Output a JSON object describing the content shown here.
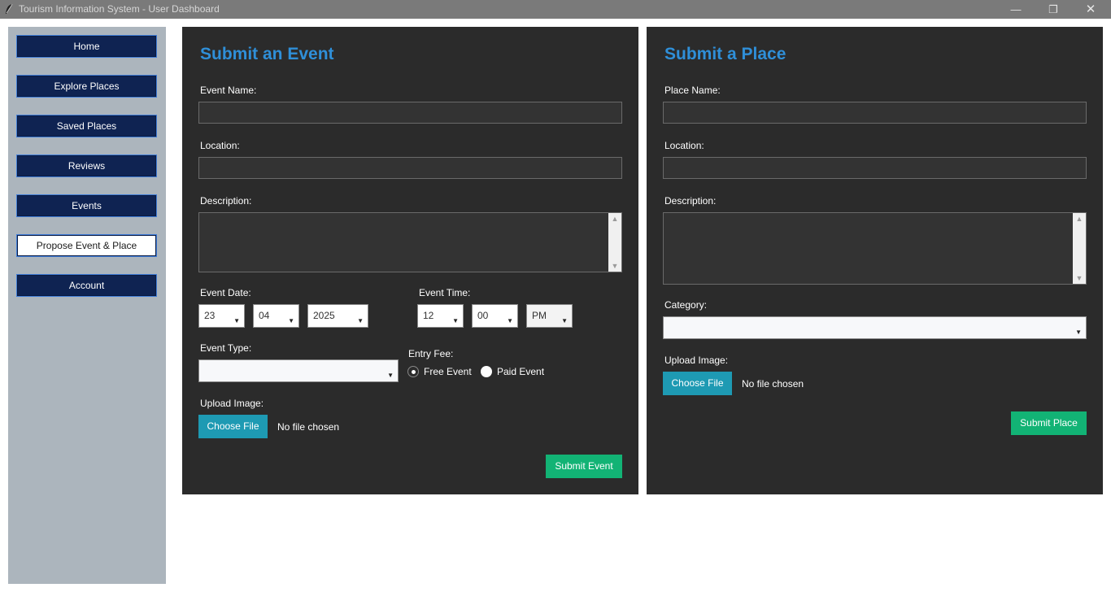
{
  "window": {
    "title": "Tourism Information System - User Dashboard",
    "icon": "feather-icon"
  },
  "sidebar": {
    "items": [
      {
        "label": "Home"
      },
      {
        "label": "Explore Places"
      },
      {
        "label": "Saved Places"
      },
      {
        "label": "Reviews"
      },
      {
        "label": "Events"
      },
      {
        "label": "Propose Event & Place",
        "active": true
      },
      {
        "label": "Account"
      }
    ]
  },
  "event_form": {
    "title": "Submit an Event",
    "name_label": "Event Name:",
    "name_value": "",
    "location_label": "Location:",
    "location_value": "",
    "description_label": "Description:",
    "description_value": "",
    "date_label": "Event Date:",
    "day": "23",
    "month": "04",
    "year": "2025",
    "time_label": "Event Time:",
    "hour": "12",
    "minute": "00",
    "ampm": "PM",
    "type_label": "Event Type:",
    "type_value": "",
    "fee_label": "Entry Fee:",
    "fee_free": "Free Event",
    "fee_paid": "Paid Event",
    "fee_selected": "Free Event",
    "upload_label": "Upload Image:",
    "choose_file": "Choose File",
    "no_file": "No file chosen",
    "submit": "Submit Event"
  },
  "place_form": {
    "title": "Submit a Place",
    "name_label": "Place Name:",
    "name_value": "",
    "location_label": "Location:",
    "location_value": "",
    "description_label": "Description:",
    "description_value": "",
    "category_label": "Category:",
    "category_value": "",
    "upload_label": "Upload Image:",
    "choose_file": "Choose File",
    "no_file": "No file chosen",
    "submit": "Submit Place"
  },
  "colors": {
    "accent_title": "#2f8fd8",
    "nav_bg": "#0f2352",
    "panel_bg": "#2b2b2b",
    "submit_bg": "#12b375",
    "choose_bg": "#1e9ab3"
  }
}
